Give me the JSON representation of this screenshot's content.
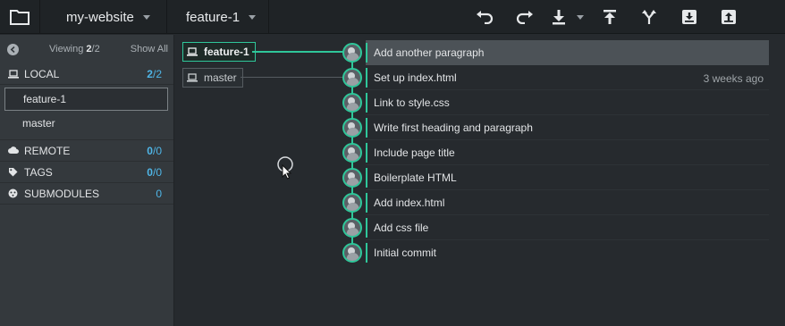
{
  "toolbar": {
    "repo": "my-website",
    "branch": "feature-1",
    "buttons": [
      "undo-icon",
      "redo-icon",
      "pull-icon",
      "push-icon",
      "branch-icon",
      "stash-icon",
      "pop-icon"
    ]
  },
  "sidebar": {
    "viewing_prefix": "Viewing ",
    "viewing_count": "2",
    "viewing_total": "/2",
    "show_all": "Show All",
    "local": {
      "label": "LOCAL",
      "count_a": "2",
      "count_b": "/2"
    },
    "branches": [
      {
        "name": "feature-1",
        "active": true
      },
      {
        "name": "master",
        "active": false
      }
    ],
    "remote": {
      "label": "REMOTE",
      "count_a": "0",
      "count_b": "/0"
    },
    "tags": {
      "label": "TAGS",
      "count_a": "0",
      "count_b": "/0"
    },
    "submodules": {
      "label": "SUBMODULES",
      "count": "0"
    }
  },
  "refs": {
    "feature": "feature-1",
    "master": "master"
  },
  "commits": [
    {
      "message": "Add another paragraph",
      "date": ""
    },
    {
      "message": "Set up index.html",
      "date": "3 weeks ago"
    },
    {
      "message": "Link to style.css",
      "date": ""
    },
    {
      "message": "Write first heading and paragraph",
      "date": ""
    },
    {
      "message": "Include page title",
      "date": ""
    },
    {
      "message": "Boilerplate HTML",
      "date": ""
    },
    {
      "message": "Add index.html",
      "date": ""
    },
    {
      "message": "Add css file",
      "date": ""
    },
    {
      "message": "Initial commit",
      "date": ""
    }
  ],
  "colors": {
    "accent": "#2fc79a",
    "count": "#4fb6e8"
  }
}
